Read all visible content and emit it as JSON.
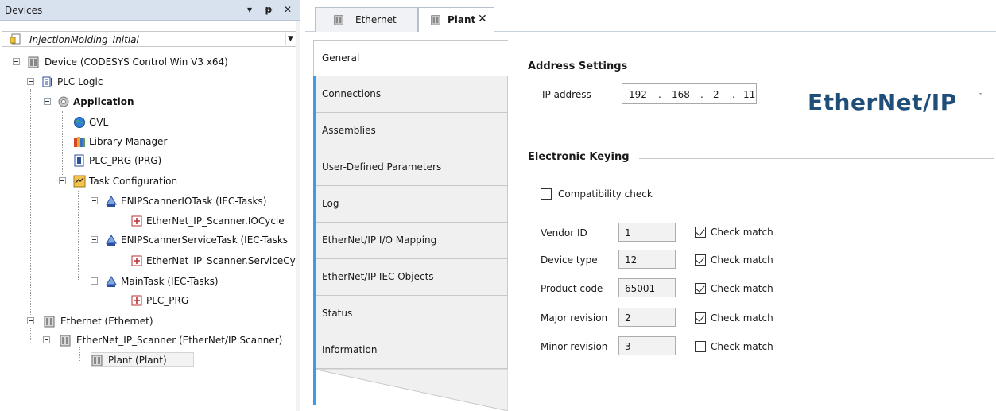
{
  "devices_pane": {
    "title": "Devices",
    "buttons": {
      "dropdown": "▾",
      "pin": "ᵽ",
      "close": "✕"
    },
    "project": "InjectionMolding_Initial",
    "tree": [
      {
        "label": "Device (CODESYS Control Win V3 x64)",
        "icon": "device-icon"
      },
      {
        "label": "PLC Logic",
        "icon": "plc-logic-icon"
      },
      {
        "label": "Application",
        "icon": "application-gear-icon"
      },
      {
        "label": "GVL",
        "icon": "globe-icon"
      },
      {
        "label": "Library Manager",
        "icon": "library-icon"
      },
      {
        "label": "PLC_PRG (PRG)",
        "icon": "program-icon"
      },
      {
        "label": "Task Configuration",
        "icon": "task-config-icon"
      },
      {
        "label": "ENIPScannerIOTask (IEC-Tasks)",
        "icon": "task-icon"
      },
      {
        "label": "EtherNet_IP_Scanner.IOCycle",
        "icon": "call-icon"
      },
      {
        "label": "ENIPScannerServiceTask (IEC-Tasks",
        "icon": "task-icon"
      },
      {
        "label": "EtherNet_IP_Scanner.ServiceCy",
        "icon": "call-icon"
      },
      {
        "label": "MainTask (IEC-Tasks)",
        "icon": "task-icon"
      },
      {
        "label": "PLC_PRG",
        "icon": "call-icon"
      },
      {
        "label": "Ethernet (Ethernet)",
        "icon": "device-icon"
      },
      {
        "label": "EtherNet_IP_Scanner (EtherNet/IP Scanner)",
        "icon": "device-icon"
      },
      {
        "label": "Plant (Plant)",
        "icon": "device-icon"
      }
    ]
  },
  "editor": {
    "tabs": [
      {
        "label": "Ethernet",
        "active": false
      },
      {
        "label": "Plant",
        "active": true,
        "close": "✕"
      }
    ],
    "nav": [
      "General",
      "Connections",
      "Assemblies",
      "User-Defined Parameters",
      "Log",
      "EtherNet/IP I/O Mapping",
      "EtherNet/IP IEC Objects",
      "Status",
      "Information"
    ],
    "address_settings": {
      "title": "Address Settings",
      "ip_label": "IP address",
      "ip": [
        "192",
        "168",
        "2",
        "11"
      ],
      "dots": [
        "."
      ]
    },
    "logo": {
      "text": "EtherNet/IP",
      "tm": "™"
    },
    "electronic_keying": {
      "title": "Electronic Keying",
      "compat_label": "Compatibility check",
      "compat_checked": false,
      "fields": [
        {
          "label": "Vendor ID",
          "value": "1",
          "check_label": "Check match",
          "checked": true
        },
        {
          "label": "Device type",
          "value": "12",
          "check_label": "Check match",
          "checked": true
        },
        {
          "label": "Product code",
          "value": "65001",
          "check_label": "Check match",
          "checked": true
        },
        {
          "label": "Major revision",
          "value": "2",
          "check_label": "Check match",
          "checked": true
        },
        {
          "label": "Minor revision",
          "value": "3",
          "check_label": "Check match",
          "checked": false
        }
      ]
    }
  },
  "colors": {
    "accent_blue": "#3f9be6",
    "header_bg": "#d8e1ee",
    "logo_blue": "#1f4e79"
  }
}
